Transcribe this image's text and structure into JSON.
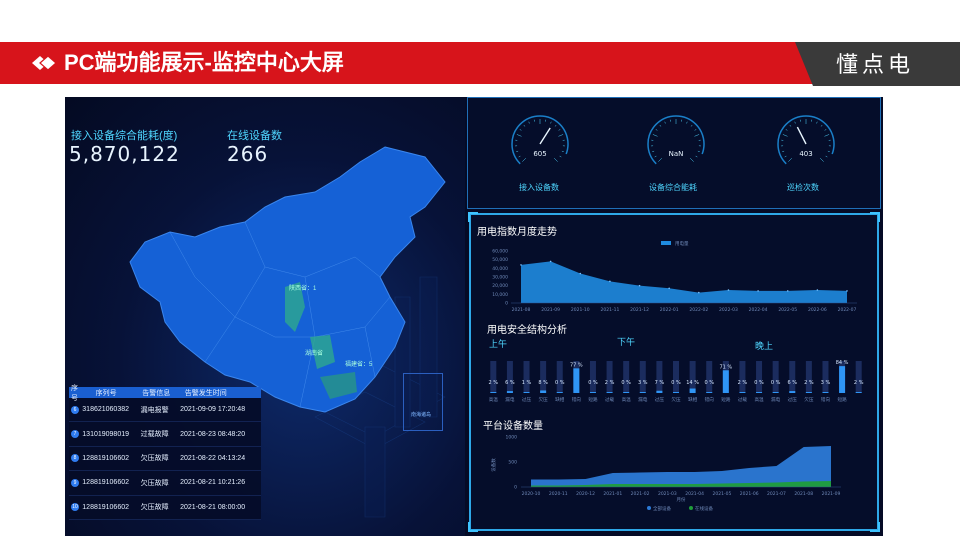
{
  "header": {
    "title": "PC端功能展示-监控中心大屏",
    "brand": "懂点电",
    "colors": {
      "red": "#d7141b",
      "dark": "#3a3a3a"
    }
  },
  "map_panel": {
    "kpis": [
      {
        "label": "接入设备综合能耗(度)",
        "value": "5,870,122"
      },
      {
        "label": "在线设备数",
        "value": "266"
      }
    ],
    "map_labels": [
      "陕西省：1",
      "湖南省",
      "福建省：5",
      "南海诸岛"
    ],
    "alarm_table": {
      "headers": [
        "序号",
        "序列号",
        "告警信息",
        "告警发生时间"
      ],
      "rows": [
        {
          "index": "6",
          "serial": "318621060382",
          "alarm": "漏电报警",
          "time": "2021-09-09 17:20:48"
        },
        {
          "index": "7",
          "serial": "131019098019",
          "alarm": "过载故障",
          "time": "2021-08-23 08:48:20"
        },
        {
          "index": "8",
          "serial": "128819106602",
          "alarm": "欠压故障",
          "time": "2021-08-22 04:13:24"
        },
        {
          "index": "9",
          "serial": "128819106602",
          "alarm": "欠压故障",
          "time": "2021-08-21 10:21:26"
        },
        {
          "index": "10",
          "serial": "128819106602",
          "alarm": "欠压故障",
          "time": "2021-08-21 08:00:00"
        }
      ]
    }
  },
  "gauges": [
    {
      "label": "接入设备数",
      "value_text": "605",
      "fraction": 0.62
    },
    {
      "label": "设备综合能耗",
      "value_text": "NaN",
      "fraction": 0
    },
    {
      "label": "巡检次数",
      "value_text": "403",
      "fraction": 0.4
    }
  ],
  "chart_data": [
    {
      "type": "area",
      "title": "用电指数月度走势",
      "legend": [
        "用电量"
      ],
      "y_ticks": [
        "60,000",
        "50,000",
        "40,000",
        "30,000",
        "20,000",
        "10,000",
        "0"
      ],
      "ylim": [
        0,
        60000
      ],
      "x": [
        "2021-08",
        "2021-09",
        "2021-10",
        "2021-11",
        "2021-12",
        "2022-01",
        "2022-02",
        "2022-03",
        "2022-04",
        "2022-05",
        "2022-06",
        "2022-07"
      ],
      "series": [
        {
          "name": "用电量",
          "values": [
            44000,
            48000,
            34000,
            25000,
            20000,
            17000,
            12000,
            15000,
            14000,
            14000,
            15000,
            14000
          ]
        }
      ],
      "color": "#1f8be0"
    },
    {
      "type": "bar",
      "title": "用电安全结构分析",
      "groups": [
        "上午",
        "下午",
        "晚上"
      ],
      "categories": [
        "高温",
        "漏电",
        "过压",
        "欠压",
        "缺相",
        "错向",
        "短路",
        "过载",
        "高温",
        "漏电",
        "过压",
        "欠压",
        "缺相",
        "错向",
        "短路",
        "过载",
        "高温",
        "漏电",
        "过压",
        "欠压",
        "错向",
        "短路"
      ],
      "values_text": [
        "2 %",
        "6 %",
        "1 %",
        "8 %",
        "0 %",
        "77 %",
        "0 %",
        "2 %",
        "0 %",
        "3 %",
        "7 %",
        "0 %",
        "14 %",
        "0 %",
        "71 %",
        "2 %",
        "0 %",
        "0 %",
        "6 %",
        "2 %",
        "3 %",
        "84 %",
        "2 %"
      ],
      "values": [
        2,
        6,
        1,
        8,
        0,
        77,
        0,
        2,
        0,
        3,
        7,
        0,
        14,
        0,
        71,
        2,
        0,
        0,
        6,
        2,
        3,
        84,
        2
      ],
      "ylim": [
        0,
        100
      ]
    },
    {
      "type": "area",
      "title": "平台设备数量",
      "ylabel": "设备数",
      "xlabel": "月份",
      "y_ticks": [
        "1000",
        "500",
        "0"
      ],
      "ylim": [
        0,
        1000
      ],
      "x": [
        "2020-10",
        "2020-11",
        "2020-12",
        "2021-01",
        "2021-02",
        "2021-03",
        "2021-04",
        "2021-05",
        "2021-06",
        "2021-07",
        "2021-08",
        "2021-09"
      ],
      "series": [
        {
          "name": "全部设备",
          "values": [
            150,
            150,
            160,
            280,
            290,
            300,
            300,
            320,
            380,
            420,
            800,
            820
          ],
          "color": "#2c7ad6"
        },
        {
          "name": "在线设备",
          "values": [
            30,
            30,
            40,
            60,
            60,
            60,
            60,
            70,
            80,
            90,
            110,
            120
          ],
          "color": "#1f9d3a"
        }
      ]
    }
  ]
}
